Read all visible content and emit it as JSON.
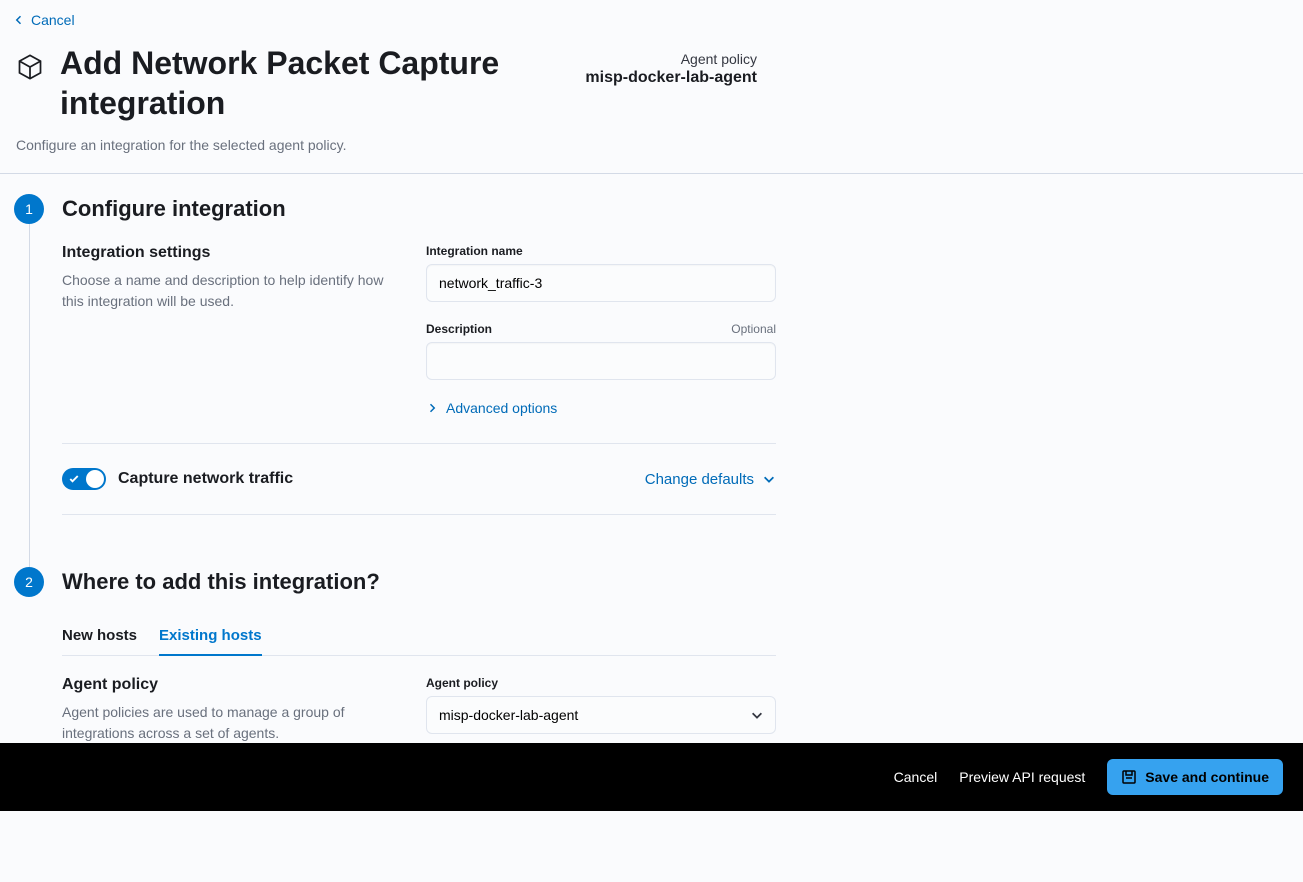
{
  "header": {
    "cancel": "Cancel",
    "title": "Add Network Packet Capture integration",
    "agent_policy_label": "Agent policy",
    "agent_policy_name": "misp-docker-lab-agent",
    "subtitle": "Configure an integration for the selected agent policy."
  },
  "step1": {
    "number": "1",
    "title": "Configure integration",
    "settings_heading": "Integration settings",
    "settings_desc": "Choose a name and description to help identify how this integration will be used.",
    "name_label": "Integration name",
    "name_value": "network_traffic-3",
    "desc_label": "Description",
    "desc_optional": "Optional",
    "desc_value": "",
    "advanced": "Advanced options",
    "toggle_label": "Capture network traffic",
    "change_defaults": "Change defaults"
  },
  "step2": {
    "number": "2",
    "title": "Where to add this integration?",
    "tabs": {
      "new": "New hosts",
      "existing": "Existing hosts"
    },
    "policy_heading": "Agent policy",
    "policy_desc": "Agent policies are used to manage a group of integrations across a set of agents.",
    "policy_select_label": "Agent policy",
    "policy_select_value": "misp-docker-lab-agent"
  },
  "footer": {
    "cancel": "Cancel",
    "preview": "Preview API request",
    "save": "Save and continue"
  }
}
